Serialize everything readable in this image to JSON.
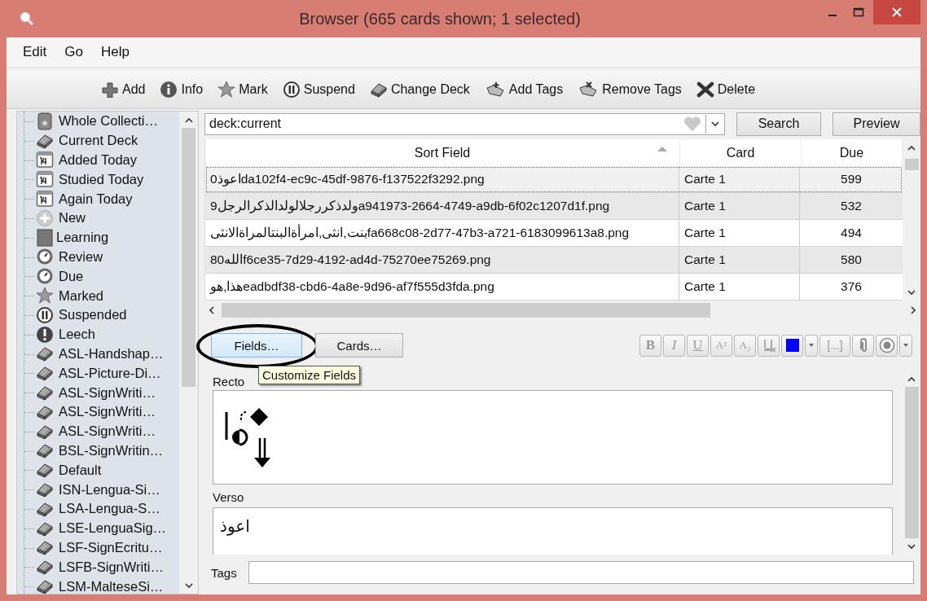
{
  "window": {
    "title": "Browser (665 cards shown; 1 selected)"
  },
  "menu": [
    "Edit",
    "Go",
    "Help"
  ],
  "toolbar": [
    {
      "kind": "add",
      "label": "Add"
    },
    {
      "kind": "info",
      "label": "Info"
    },
    {
      "kind": "mark",
      "label": "Mark"
    },
    {
      "kind": "suspend",
      "label": "Suspend"
    },
    {
      "kind": "deck",
      "label": "Change Deck"
    },
    {
      "kind": "addtags",
      "label": "Add Tags"
    },
    {
      "kind": "removetags",
      "label": "Remove Tags"
    },
    {
      "kind": "delete",
      "label": "Delete"
    }
  ],
  "sidebar": {
    "items": [
      {
        "kind": "collection",
        "label": "Whole Collecti…"
      },
      {
        "kind": "deck",
        "label": "Current Deck"
      },
      {
        "kind": "calendar",
        "label": "Added Today"
      },
      {
        "kind": "calendar",
        "label": "Studied Today"
      },
      {
        "kind": "calendar",
        "label": "Again Today"
      },
      {
        "kind": "new",
        "label": "New"
      },
      {
        "kind": "learning",
        "label": "Learning"
      },
      {
        "kind": "clock",
        "label": "Review"
      },
      {
        "kind": "clock",
        "label": "Due"
      },
      {
        "kind": "star",
        "label": "Marked"
      },
      {
        "kind": "pause",
        "label": "Suspended"
      },
      {
        "kind": "leech",
        "label": "Leech"
      },
      {
        "kind": "deck",
        "label": "ASL-Handshap…"
      },
      {
        "kind": "deck",
        "label": "ASL-Picture-Di…"
      },
      {
        "kind": "deck",
        "label": "ASL-SignWriti…"
      },
      {
        "kind": "deck",
        "label": "ASL-SignWriti…"
      },
      {
        "kind": "deck",
        "label": "ASL-SignWriti…"
      },
      {
        "kind": "deck",
        "label": "BSL-SignWritin…"
      },
      {
        "kind": "deck",
        "label": "Default"
      },
      {
        "kind": "deck",
        "label": "ISN-Lengua-Si…"
      },
      {
        "kind": "deck",
        "label": "LSA-Lengua-S…"
      },
      {
        "kind": "deck",
        "label": "LSE-LenguaSig…"
      },
      {
        "kind": "deck",
        "label": "LSF-SignEcritu…"
      },
      {
        "kind": "deck",
        "label": "LSFB-SignWriti…"
      },
      {
        "kind": "deck",
        "label": "LSM-MalteseSi…"
      }
    ]
  },
  "search": {
    "value": "deck:current",
    "search_button": "Search",
    "preview_button": "Preview"
  },
  "table": {
    "columns": [
      {
        "label": "Sort Field",
        "sorted": true
      },
      {
        "label": "Card",
        "sorted": false
      },
      {
        "label": "Due",
        "sorted": false
      }
    ],
    "rows": [
      {
        "cells": [
          "اعوذ0da102f4-ec9c-45df-9876-f137522f3292.png",
          "Carte 1",
          "599"
        ],
        "selected": true
      },
      {
        "cells": [
          "ولدذكررجلالولدالذكرالرجل9a941973-2664-4749-a9db-6f02c1207d1f.png",
          "Carte 1",
          "532"
        ],
        "selected": false
      },
      {
        "cells": [
          "بنت,انثى,امرأةالبنتالمراةالانثىfa668c08-2d77-47b3-a721-6183099613a8.png",
          "Carte 1",
          "494"
        ],
        "selected": false
      },
      {
        "cells": [
          "الله80f6ce35-7d29-4192-ad4d-75270ee75269.png",
          "Carte 1",
          "580"
        ],
        "selected": false
      },
      {
        "cells": [
          "هذا,هوeadbdf38-cbd6-4a8e-9d96-af7f555d3fda.png",
          "Carte 1",
          "376"
        ],
        "selected": false
      }
    ]
  },
  "editor": {
    "buttons": [
      {
        "label": "Fields…",
        "circled": true
      },
      {
        "label": "Cards…",
        "circled": false
      }
    ],
    "tooltip": "Customize Fields",
    "format_buttons": [
      {
        "kind": "bold",
        "label": "B"
      },
      {
        "kind": "italic",
        "label": "I"
      },
      {
        "kind": "underline",
        "label": "U"
      },
      {
        "kind": "sup",
        "label": "A²"
      },
      {
        "kind": "sub",
        "label": "A₂"
      },
      {
        "kind": "clear"
      },
      {
        "kind": "color",
        "color": "#0000ff"
      },
      {
        "kind": "dropdown"
      },
      {
        "kind": "text",
        "label": "[...]"
      },
      {
        "kind": "attach"
      },
      {
        "kind": "record"
      },
      {
        "kind": "dropdown"
      }
    ],
    "fields": [
      {
        "name": "Recto",
        "kind": "image"
      },
      {
        "name": "Verso",
        "kind": "text",
        "value": "اعوذ"
      }
    ],
    "tags_label": "Tags"
  }
}
